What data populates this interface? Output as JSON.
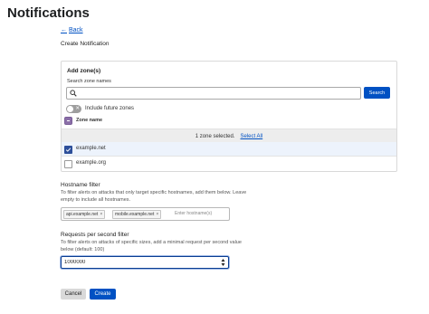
{
  "page": {
    "title": "Notifications"
  },
  "nav": {
    "back_label": "Back",
    "back_arrow": "←"
  },
  "form": {
    "section_title": "Create Notification"
  },
  "zones": {
    "heading": "Add zone(s)",
    "search_label": "Search zone names",
    "search_value": "",
    "search_button": "Search",
    "include_future_label": "Include future zones",
    "include_future_enabled": false,
    "column_header": "Zone name",
    "selected_count_text": "1 zone selected.",
    "select_all_label": "Select All",
    "rows": [
      {
        "name": "example.net",
        "checked": true
      },
      {
        "name": "example.org",
        "checked": false
      }
    ]
  },
  "hostname_filter": {
    "title": "Hostname filter",
    "help": "To filter alerts on attacks that only target specific hostnames, add them below. Leave empty to include all hostnames.",
    "tags": [
      "api.example.net",
      "mobile.example.net"
    ],
    "input_placeholder": "Enter hostname(s)"
  },
  "rps_filter": {
    "title": "Requests per second filter",
    "help": "To filter alerts on attacks of specific sizes, add a minimal request per second value below (default: 100)",
    "value": "1000000"
  },
  "actions": {
    "cancel_label": "Cancel",
    "create_label": "Create"
  },
  "colors": {
    "accent": "#0051c3",
    "selected_row": "#edf3fc",
    "banner": "#ededed"
  }
}
